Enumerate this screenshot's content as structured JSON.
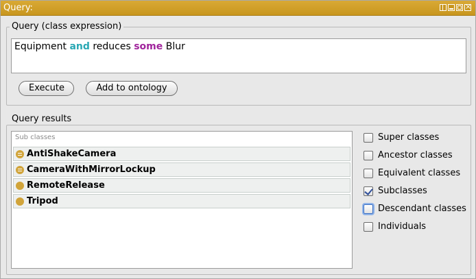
{
  "window": {
    "title": "Query:"
  },
  "query_group": {
    "legend": "Query (class expression)",
    "expression": {
      "part1": "Equipment ",
      "and": "and",
      "part2": " reduces ",
      "some": "some",
      "part3": " Blur"
    },
    "execute_label": "Execute",
    "add_label": "Add to ontology"
  },
  "results_group": {
    "legend": "Query results",
    "list_header": "Sub classes",
    "items": [
      {
        "label": "AntiShakeCamera",
        "icon": "equivalent-class-icon"
      },
      {
        "label": "CameraWithMirrorLockup",
        "icon": "equivalent-class-icon"
      },
      {
        "label": "RemoteRelease",
        "icon": "class-icon"
      },
      {
        "label": "Tripod",
        "icon": "class-icon"
      }
    ],
    "options": [
      {
        "label": "Super classes",
        "checked": false
      },
      {
        "label": "Ancestor classes",
        "checked": false
      },
      {
        "label": "Equivalent classes",
        "checked": false
      },
      {
        "label": "Subclasses",
        "checked": true
      },
      {
        "label": "Descendant classes",
        "checked": false
      },
      {
        "label": "Individuals",
        "checked": false
      }
    ]
  },
  "colors": {
    "titlebar": "#c8961e",
    "keyword_and": "#2aa8b4",
    "keyword_some": "#a0249c",
    "class_icon": "#d1a43a"
  }
}
